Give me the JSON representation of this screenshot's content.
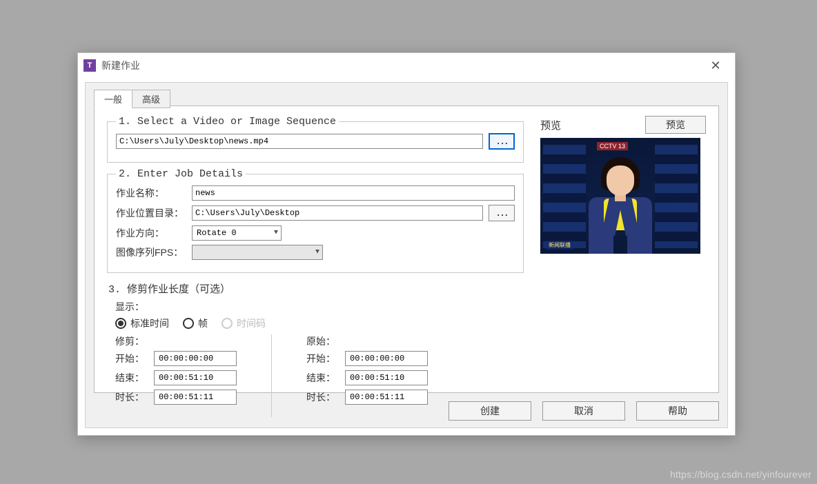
{
  "window": {
    "title": "新建作业",
    "app_icon_letter": "T"
  },
  "tabs": {
    "general": "一般",
    "advanced": "高级"
  },
  "section1": {
    "legend": "1. Select a Video or Image Sequence",
    "file_path": "C:\\Users\\July\\Desktop\\news.mp4",
    "browse": "..."
  },
  "section2": {
    "legend": "2. Enter Job Details",
    "job_name_label": "作业名称：",
    "job_name_value": "news",
    "job_location_label": "作业位置目录：",
    "job_location_value": "C:\\Users\\July\\Desktop",
    "browse": "...",
    "orientation_label": "作业方向：",
    "orientation_value": "Rotate 0",
    "fps_label": "图像序列FPS：",
    "fps_value": ""
  },
  "section3": {
    "title": "3. 修剪作业长度（可选）",
    "display_label": "显示：",
    "radio_std": "标准时间",
    "radio_frame": "帧",
    "radio_tc": "时间码",
    "trim_header": "修剪：",
    "orig_header": "原始：",
    "start_label": "开始：",
    "end_label": "结束：",
    "dur_label": "时长：",
    "trim_start": "00:00:00:00",
    "trim_end": "00:00:51:10",
    "trim_dur": "00:00:51:11",
    "orig_start": "00:00:00:00",
    "orig_end": "00:00:51:10",
    "orig_dur": "00:00:51:11"
  },
  "preview": {
    "title": "预览",
    "button": "预览",
    "channel_badge": "CCTV 13",
    "ticker": "新闻联播"
  },
  "buttons": {
    "create": "创建",
    "cancel": "取消",
    "help": "帮助"
  },
  "watermark": "https://blog.csdn.net/yinfourever"
}
